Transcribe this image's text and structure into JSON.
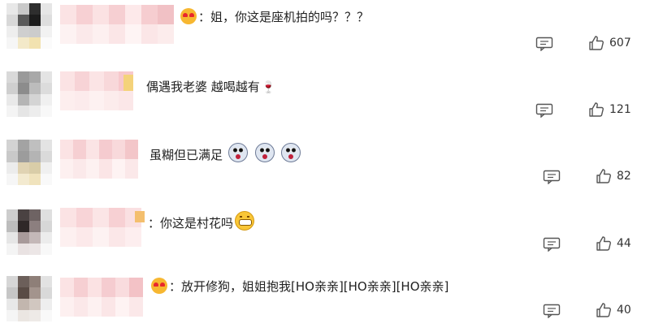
{
  "comments": [
    {
      "text": "：姐，你这是座机拍的吗？？？",
      "likes": "607",
      "emoji": "love-emoji"
    },
    {
      "text": "偶遇我老婆 越喝越有",
      "likes": "121",
      "emoji": "wine-glass"
    },
    {
      "text": "虽糊但已满足",
      "likes": "82",
      "emoji": "scared-face-emoji"
    },
    {
      "text": "：你这是村花吗",
      "likes": "44",
      "emoji": "grin-emoji"
    },
    {
      "text": "：放开修狗，姐姐抱我[HO亲亲][HO亲亲][HO亲亲]",
      "likes": "40",
      "emoji": "love-emoji"
    }
  ],
  "icons": {
    "reply": "comment-icon",
    "like": "thumbs-up-icon"
  },
  "colors": {
    "text": "#222222",
    "icon": "#555555",
    "love_emoji_heart": "#e8262e",
    "love_emoji_face": "#f7b731",
    "avatar_pink": "#f4c9cc",
    "avatar_dark": "#3a3232"
  }
}
